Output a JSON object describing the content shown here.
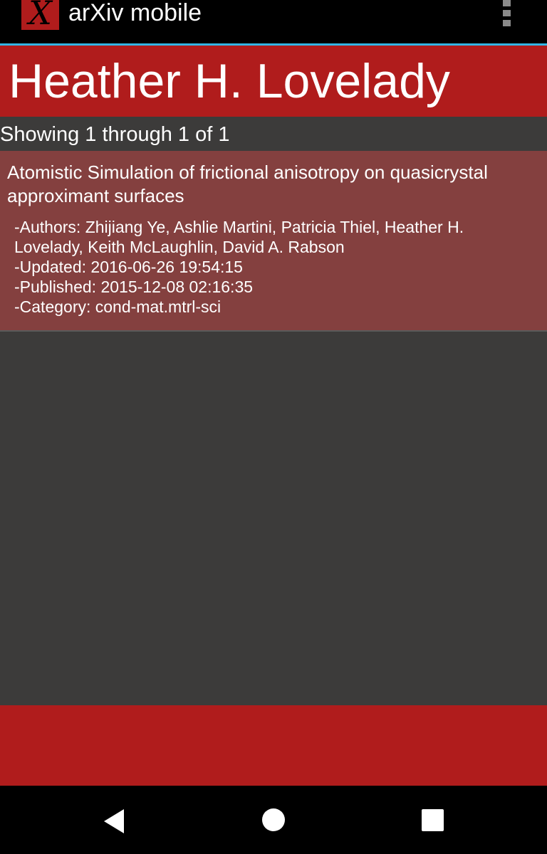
{
  "action_bar": {
    "app_icon_letter": "X",
    "title": "arXiv mobile",
    "menu_icon": "overflow-menu-icon"
  },
  "header": {
    "author_name": "Heather H. Lovelady"
  },
  "results": {
    "summary": "Showing 1 through 1 of 1",
    "items": [
      {
        "title": "Atomistic Simulation of frictional anisotropy on quasicrystal approximant surfaces",
        "authors": "-Authors: Zhijiang Ye, Ashlie Martini, Patricia Thiel, Heather H. Lovelady, Keith McLaughlin, David A. Rabson",
        "updated": "-Updated: 2016-06-26 19:54:15",
        "published": "-Published: 2015-12-08 02:16:35",
        "category": "-Category: cond-mat.mtrl-sci"
      }
    ]
  },
  "nav_bar": {
    "back_icon": "back-triangle-icon",
    "home_icon": "home-circle-icon",
    "recents_icon": "recents-square-icon"
  },
  "colors": {
    "accent_red": "#b01c1c",
    "card_background": "#84403f",
    "page_background": "#3c3b3a",
    "action_bar_divider": "#33b5e5"
  }
}
